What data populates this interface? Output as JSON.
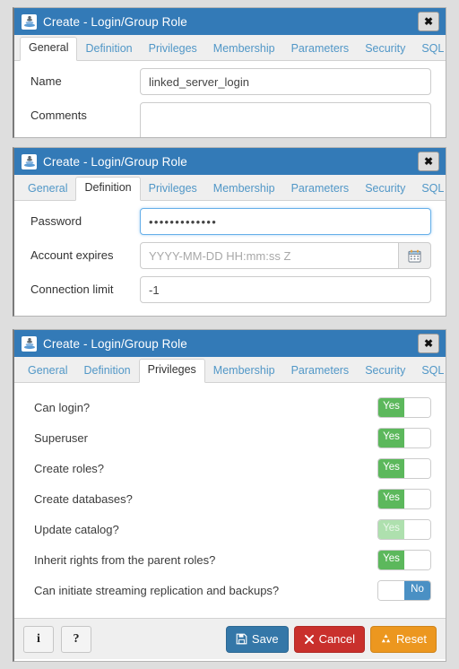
{
  "window": {
    "title": "Create - Login/Group Role",
    "icon": "login-group-role-icon",
    "close_label": "✖"
  },
  "colors": {
    "titlebar": "#337ab7",
    "tab_link": "#5197c7",
    "toggle_on": "#5cb85c",
    "toggle_on_disabled": "#aee0ae",
    "toggle_off": "#4a90c4",
    "save": "#3477a8",
    "cancel": "#c9302c",
    "reset": "#ec971f"
  },
  "tabs": [
    {
      "label": "General"
    },
    {
      "label": "Definition"
    },
    {
      "label": "Privileges"
    },
    {
      "label": "Membership"
    },
    {
      "label": "Parameters"
    },
    {
      "label": "Security"
    },
    {
      "label": "SQL"
    }
  ],
  "panels": [
    {
      "id": "general",
      "active_tab": "General",
      "fields": [
        {
          "label": "Name",
          "value": "linked_server_login",
          "placeholder": ""
        },
        {
          "label": "Comments",
          "value": "",
          "placeholder": ""
        }
      ]
    },
    {
      "id": "definition",
      "active_tab": "Definition",
      "fields": [
        {
          "label": "Password",
          "value": "•••••••••••••",
          "placeholder": ""
        },
        {
          "label": "Account expires",
          "value": "",
          "placeholder": "YYYY-MM-DD HH:mm:ss Z",
          "addon_icon": "calendar-icon"
        },
        {
          "label": "Connection limit",
          "value": "-1",
          "placeholder": ""
        }
      ]
    },
    {
      "id": "privileges",
      "active_tab": "Privileges",
      "rows": [
        {
          "label": "Can login?",
          "state": "Yes",
          "on": true,
          "disabled": false
        },
        {
          "label": "Superuser",
          "state": "Yes",
          "on": true,
          "disabled": false
        },
        {
          "label": "Create roles?",
          "state": "Yes",
          "on": true,
          "disabled": false
        },
        {
          "label": "Create databases?",
          "state": "Yes",
          "on": true,
          "disabled": false
        },
        {
          "label": "Update catalog?",
          "state": "Yes",
          "on": true,
          "disabled": true
        },
        {
          "label": "Inherit rights from the parent roles?",
          "state": "Yes",
          "on": true,
          "disabled": false
        },
        {
          "label": "Can initiate streaming replication and backups?",
          "state": "No",
          "on": false,
          "disabled": false
        }
      ]
    }
  ],
  "toggle_labels": {
    "yes": "Yes",
    "no": "No"
  },
  "footer": {
    "info_label": "i",
    "help_label": "?",
    "save_label": "Save",
    "cancel_label": "Cancel",
    "reset_label": "Reset"
  }
}
